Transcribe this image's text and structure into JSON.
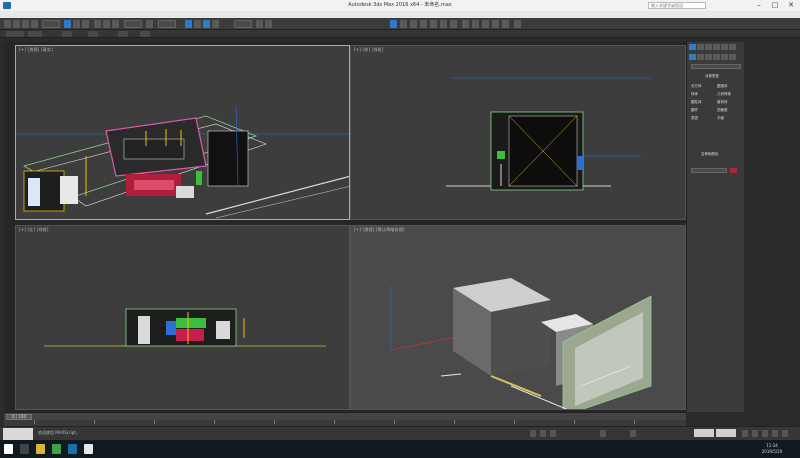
{
  "window": {
    "title": "Autodesk 3ds Max 2016 x64 - 未命名.max",
    "search_placeholder": "输入关键字或短语",
    "minimize_glyph": "–",
    "maximize_glyph": "□",
    "close_glyph": "✕"
  },
  "viewports": {
    "top_left_label": "[+] [透视] [真实]",
    "top_right_label": "[+] [前] [线框]",
    "bottom_left_label": "[+] [左] [线框]",
    "bottom_right_label": "[+] [透视] [默认明暗处理]"
  },
  "command_panel": {
    "rollout_title": "对象类型",
    "buttons": [
      "长方体",
      "圆锥体",
      "球体",
      "几何球体",
      "圆柱体",
      "管状体",
      "圆环",
      "四棱锥",
      "茶壶",
      "平面"
    ],
    "name_color_title": "名称和颜色",
    "accent": "#2e7cc8",
    "object_color": "#a5293b"
  },
  "timeline": {
    "slider": "0 / 100"
  },
  "status": {
    "prompt": "欢迎使用 MAXScript。",
    "clock_time": "11:34",
    "clock_date": "2019/5/20"
  },
  "colors": {
    "active_border": "#c8b820",
    "viewport_bg": "#3d3d3d",
    "wire_green": "#8fd18f",
    "wire_white": "#e6e6e6",
    "axis_blue": "#2a6fd6",
    "accent_pink": "#e05aa8"
  }
}
